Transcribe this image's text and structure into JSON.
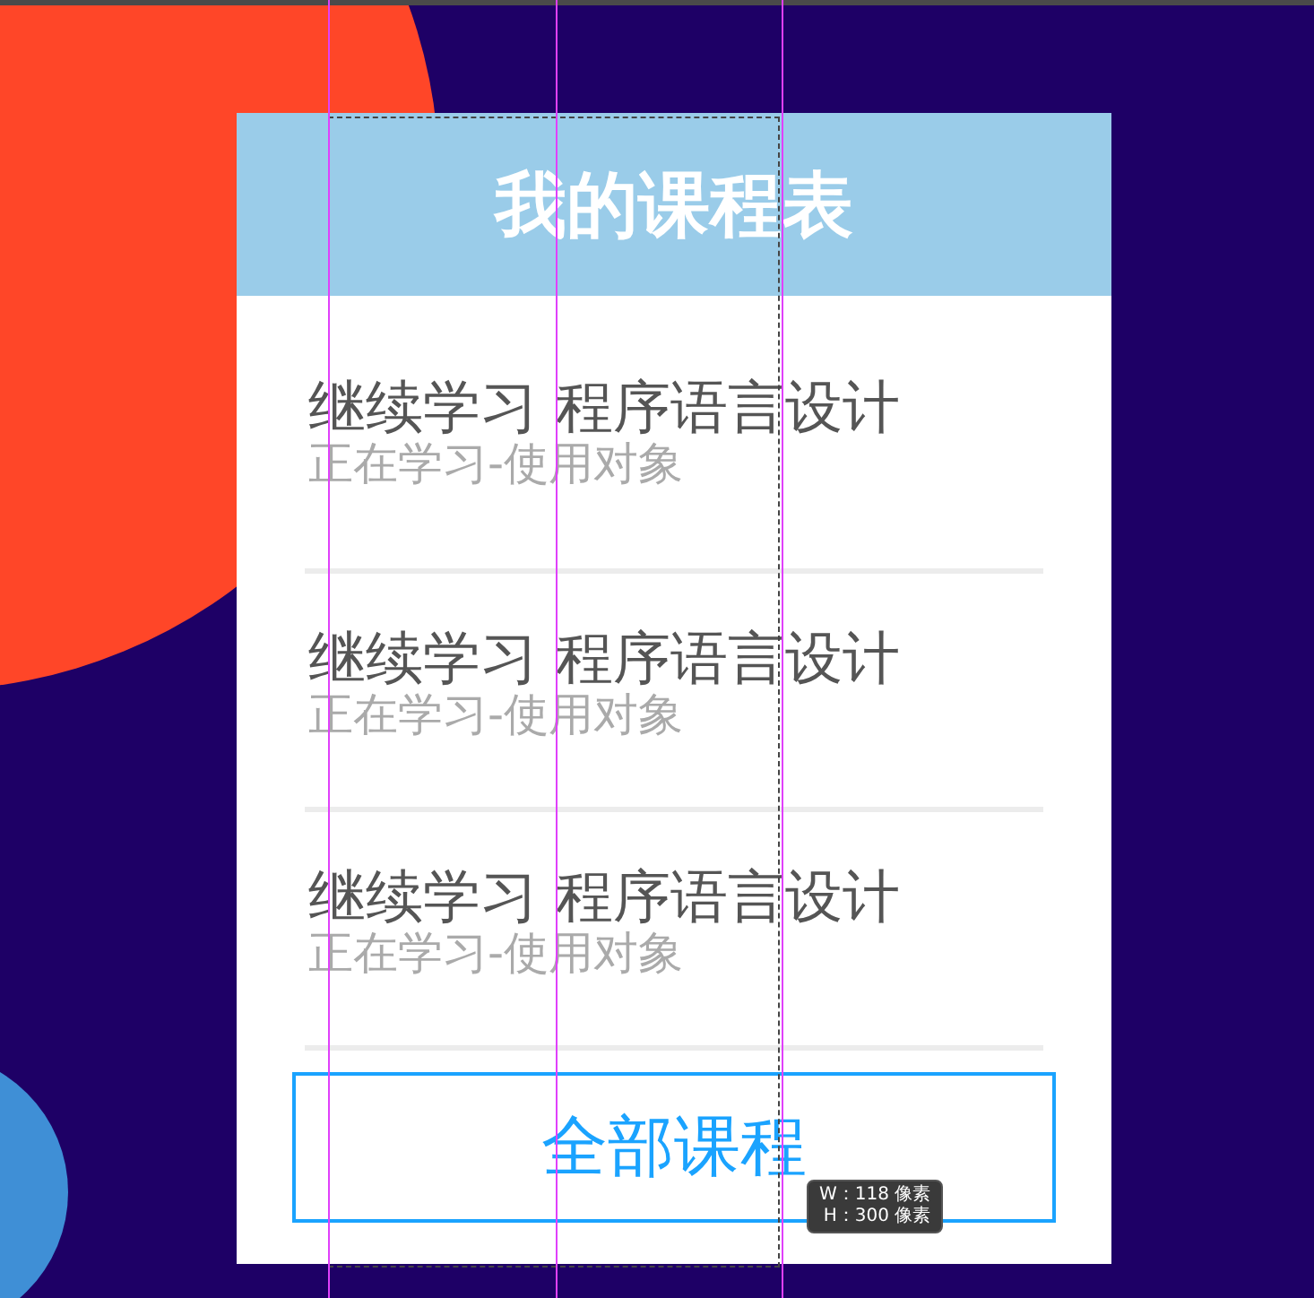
{
  "header": {
    "title": "我的课程表"
  },
  "courses": [
    {
      "title": "继续学习 程序语言设计",
      "status": "正在学习-使用对象"
    },
    {
      "title": "继续学习 程序语言设计",
      "status": "正在学习-使用对象"
    },
    {
      "title": "继续学习 程序语言设计",
      "status": "正在学习-使用对象"
    }
  ],
  "all_button": {
    "label": "全部课程"
  },
  "size_tooltip": {
    "lines": [
      "W：118 像素",
      "H：300 像素"
    ]
  }
}
